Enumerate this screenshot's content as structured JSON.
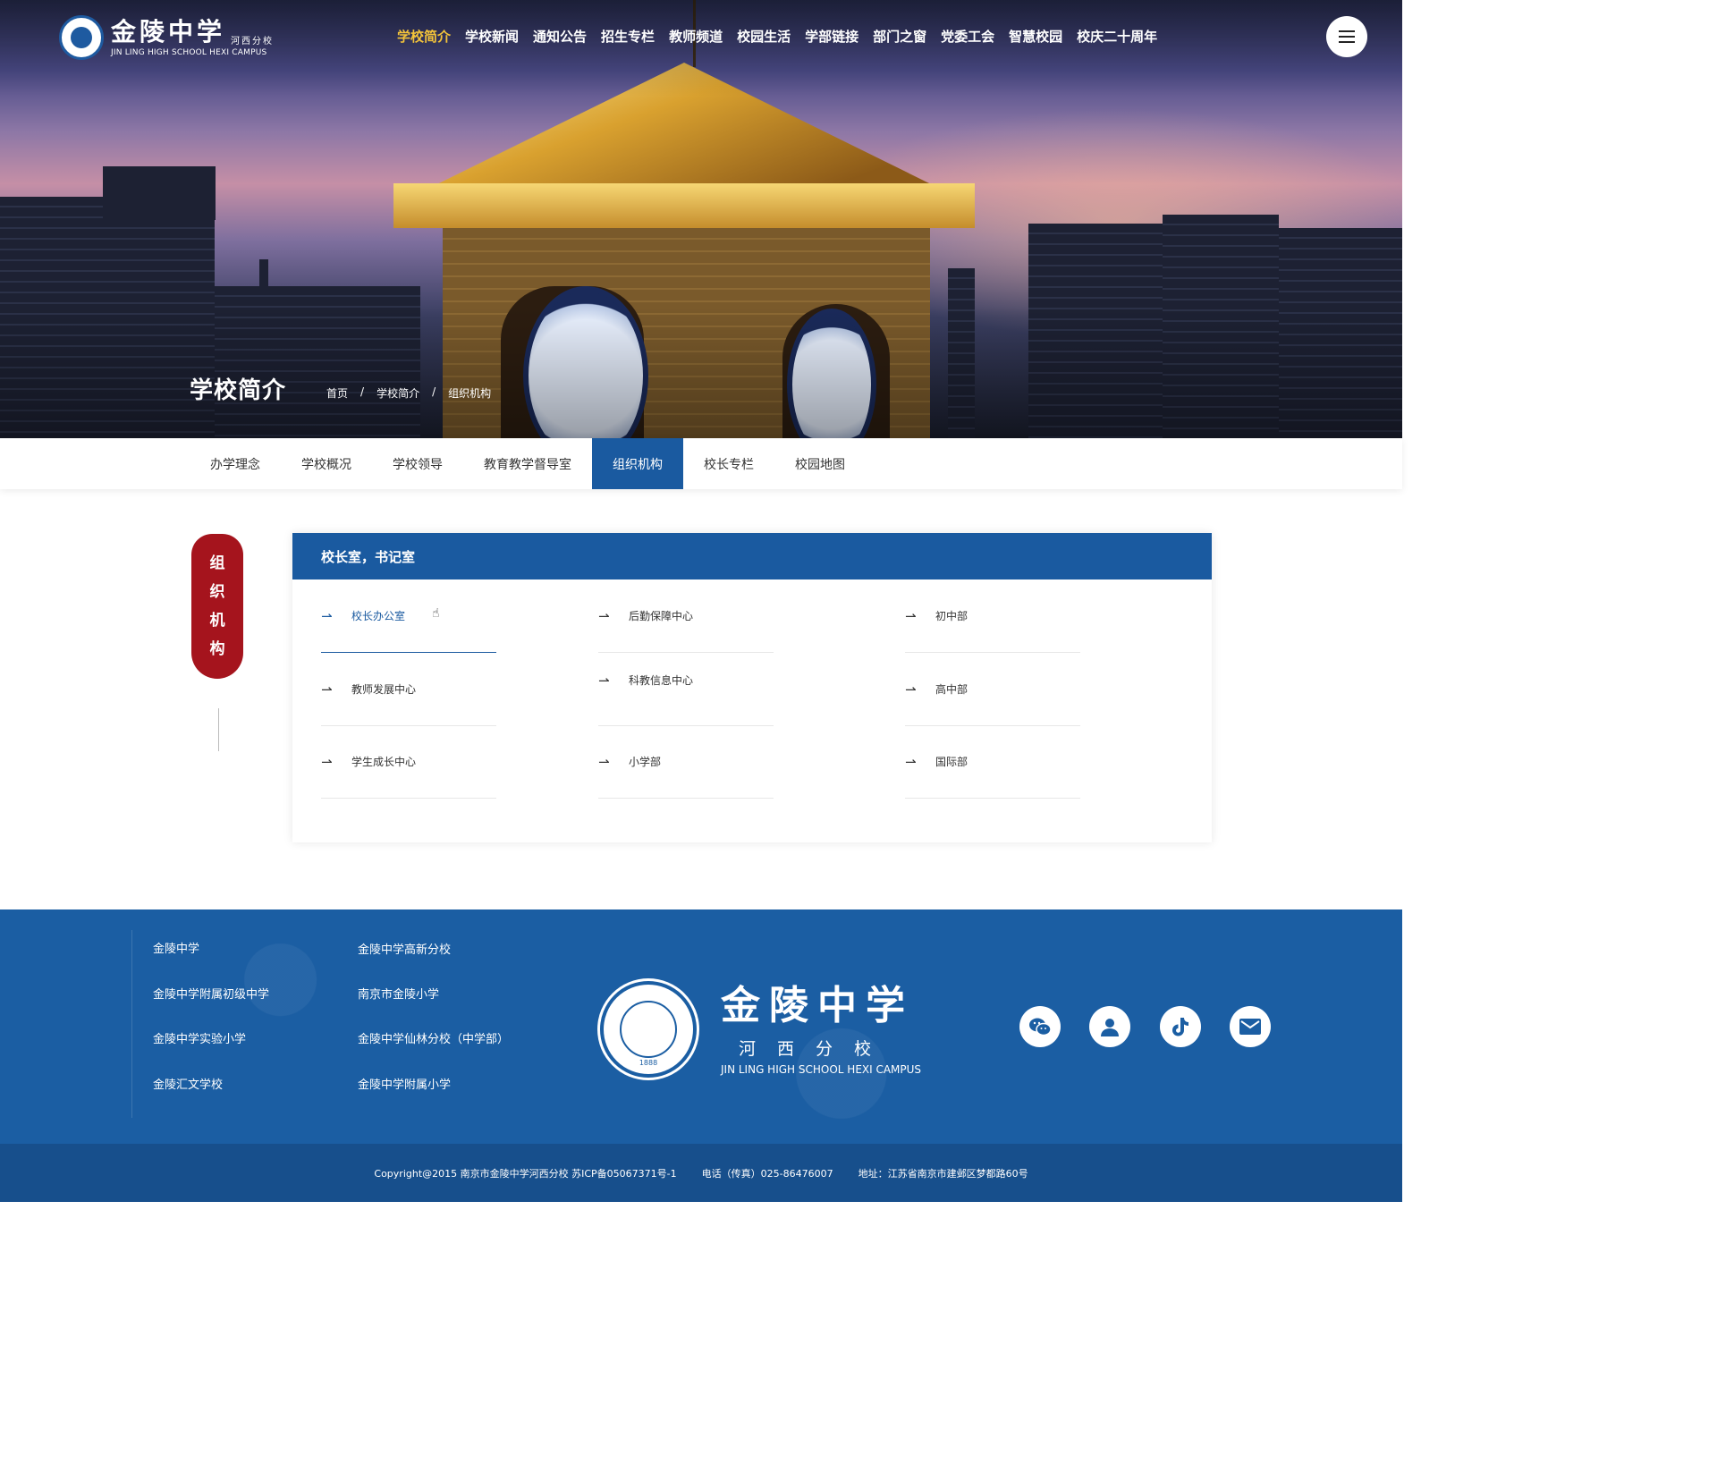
{
  "header": {
    "logo_cn": "金陵中学",
    "logo_sub": "河西分校",
    "logo_en": "JIN LING HIGH SCHOOL HEXI CAMPUS",
    "nav": [
      "学校简介",
      "学校新闻",
      "通知公告",
      "招生专栏",
      "教师频道",
      "校园生活",
      "学部链接",
      "部门之窗",
      "党委工会",
      "智慧校园",
      "校庆二十周年"
    ],
    "active_nav": "学校简介",
    "menu_icon": "hamburger-icon"
  },
  "hero": {
    "title": "学校简介",
    "breadcrumb": [
      "首页",
      "学校简介",
      "组织机构"
    ],
    "breadcrumb_sep": "/"
  },
  "subnav": {
    "items": [
      "办学理念",
      "学校概况",
      "学校领导",
      "教育教学督导室",
      "组织机构",
      "校长专栏",
      "校园地图"
    ],
    "active": "组织机构"
  },
  "side_seal": {
    "chars": [
      "组",
      "织",
      "机",
      "构"
    ]
  },
  "card": {
    "title": "校长室，书记室",
    "departments": [
      {
        "label": "校长办公室",
        "active": true
      },
      {
        "label": "后勤保障中心",
        "active": false
      },
      {
        "label": "初中部",
        "active": false
      },
      {
        "label": "教师发展中心",
        "active": false
      },
      {
        "label": "科教信息中心",
        "active": false
      },
      {
        "label": "高中部",
        "active": false
      },
      {
        "label": "学生成长中心",
        "active": false
      },
      {
        "label": "小学部",
        "active": false
      },
      {
        "label": "国际部",
        "active": false
      }
    ],
    "arrow_glyph": "⇀"
  },
  "footer": {
    "links_col1": [
      "金陵中学",
      "金陵中学附属初级中学",
      "金陵中学实验小学",
      "金陵汇文学校"
    ],
    "links_col2": [
      "金陵中学高新分校",
      "南京市金陵小学",
      "金陵中学仙林分校（中学部）",
      "金陵中学附属小学"
    ],
    "logo_cn": "金陵中学",
    "logo_sub": "河西分校",
    "logo_en": "JIN LING HIGH SCHOOL HEXI CAMPUS",
    "emblem_year": "1888",
    "social_icons": [
      "wechat-icon",
      "user-icon",
      "tiktok-icon",
      "mail-icon"
    ],
    "copyright": "Copyright@2015 南京市金陵中学河西分校  苏ICP备05067371号-1",
    "phone": "电话（传真）025-86476007",
    "address": "地址：江苏省南京市建邺区梦都路60号"
  },
  "colors": {
    "brand_blue": "#1a5aa0",
    "seal_red": "#a5141d",
    "nav_active": "#f4c43a"
  }
}
